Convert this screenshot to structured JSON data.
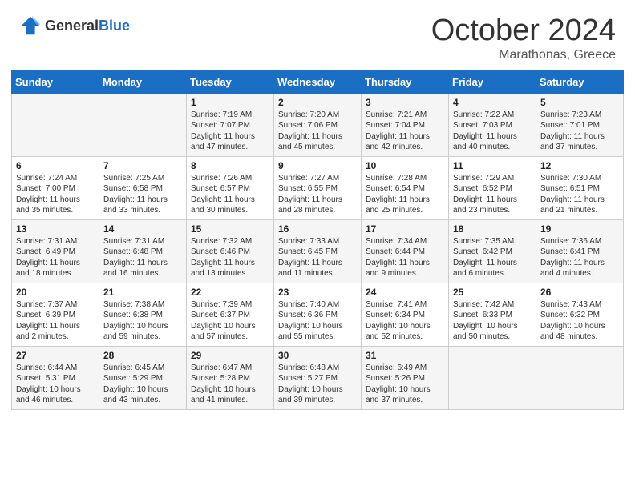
{
  "header": {
    "logo_general": "General",
    "logo_blue": "Blue",
    "month": "October 2024",
    "location": "Marathonas, Greece"
  },
  "weekdays": [
    "Sunday",
    "Monday",
    "Tuesday",
    "Wednesday",
    "Thursday",
    "Friday",
    "Saturday"
  ],
  "weeks": [
    [
      {
        "day": "",
        "sunrise": "",
        "sunset": "",
        "daylight": ""
      },
      {
        "day": "",
        "sunrise": "",
        "sunset": "",
        "daylight": ""
      },
      {
        "day": "1",
        "sunrise": "Sunrise: 7:19 AM",
        "sunset": "Sunset: 7:07 PM",
        "daylight": "Daylight: 11 hours and 47 minutes."
      },
      {
        "day": "2",
        "sunrise": "Sunrise: 7:20 AM",
        "sunset": "Sunset: 7:06 PM",
        "daylight": "Daylight: 11 hours and 45 minutes."
      },
      {
        "day": "3",
        "sunrise": "Sunrise: 7:21 AM",
        "sunset": "Sunset: 7:04 PM",
        "daylight": "Daylight: 11 hours and 42 minutes."
      },
      {
        "day": "4",
        "sunrise": "Sunrise: 7:22 AM",
        "sunset": "Sunset: 7:03 PM",
        "daylight": "Daylight: 11 hours and 40 minutes."
      },
      {
        "day": "5",
        "sunrise": "Sunrise: 7:23 AM",
        "sunset": "Sunset: 7:01 PM",
        "daylight": "Daylight: 11 hours and 37 minutes."
      }
    ],
    [
      {
        "day": "6",
        "sunrise": "Sunrise: 7:24 AM",
        "sunset": "Sunset: 7:00 PM",
        "daylight": "Daylight: 11 hours and 35 minutes."
      },
      {
        "day": "7",
        "sunrise": "Sunrise: 7:25 AM",
        "sunset": "Sunset: 6:58 PM",
        "daylight": "Daylight: 11 hours and 33 minutes."
      },
      {
        "day": "8",
        "sunrise": "Sunrise: 7:26 AM",
        "sunset": "Sunset: 6:57 PM",
        "daylight": "Daylight: 11 hours and 30 minutes."
      },
      {
        "day": "9",
        "sunrise": "Sunrise: 7:27 AM",
        "sunset": "Sunset: 6:55 PM",
        "daylight": "Daylight: 11 hours and 28 minutes."
      },
      {
        "day": "10",
        "sunrise": "Sunrise: 7:28 AM",
        "sunset": "Sunset: 6:54 PM",
        "daylight": "Daylight: 11 hours and 25 minutes."
      },
      {
        "day": "11",
        "sunrise": "Sunrise: 7:29 AM",
        "sunset": "Sunset: 6:52 PM",
        "daylight": "Daylight: 11 hours and 23 minutes."
      },
      {
        "day": "12",
        "sunrise": "Sunrise: 7:30 AM",
        "sunset": "Sunset: 6:51 PM",
        "daylight": "Daylight: 11 hours and 21 minutes."
      }
    ],
    [
      {
        "day": "13",
        "sunrise": "Sunrise: 7:31 AM",
        "sunset": "Sunset: 6:49 PM",
        "daylight": "Daylight: 11 hours and 18 minutes."
      },
      {
        "day": "14",
        "sunrise": "Sunrise: 7:31 AM",
        "sunset": "Sunset: 6:48 PM",
        "daylight": "Daylight: 11 hours and 16 minutes."
      },
      {
        "day": "15",
        "sunrise": "Sunrise: 7:32 AM",
        "sunset": "Sunset: 6:46 PM",
        "daylight": "Daylight: 11 hours and 13 minutes."
      },
      {
        "day": "16",
        "sunrise": "Sunrise: 7:33 AM",
        "sunset": "Sunset: 6:45 PM",
        "daylight": "Daylight: 11 hours and 11 minutes."
      },
      {
        "day": "17",
        "sunrise": "Sunrise: 7:34 AM",
        "sunset": "Sunset: 6:44 PM",
        "daylight": "Daylight: 11 hours and 9 minutes."
      },
      {
        "day": "18",
        "sunrise": "Sunrise: 7:35 AM",
        "sunset": "Sunset: 6:42 PM",
        "daylight": "Daylight: 11 hours and 6 minutes."
      },
      {
        "day": "19",
        "sunrise": "Sunrise: 7:36 AM",
        "sunset": "Sunset: 6:41 PM",
        "daylight": "Daylight: 11 hours and 4 minutes."
      }
    ],
    [
      {
        "day": "20",
        "sunrise": "Sunrise: 7:37 AM",
        "sunset": "Sunset: 6:39 PM",
        "daylight": "Daylight: 11 hours and 2 minutes."
      },
      {
        "day": "21",
        "sunrise": "Sunrise: 7:38 AM",
        "sunset": "Sunset: 6:38 PM",
        "daylight": "Daylight: 10 hours and 59 minutes."
      },
      {
        "day": "22",
        "sunrise": "Sunrise: 7:39 AM",
        "sunset": "Sunset: 6:37 PM",
        "daylight": "Daylight: 10 hours and 57 minutes."
      },
      {
        "day": "23",
        "sunrise": "Sunrise: 7:40 AM",
        "sunset": "Sunset: 6:36 PM",
        "daylight": "Daylight: 10 hours and 55 minutes."
      },
      {
        "day": "24",
        "sunrise": "Sunrise: 7:41 AM",
        "sunset": "Sunset: 6:34 PM",
        "daylight": "Daylight: 10 hours and 52 minutes."
      },
      {
        "day": "25",
        "sunrise": "Sunrise: 7:42 AM",
        "sunset": "Sunset: 6:33 PM",
        "daylight": "Daylight: 10 hours and 50 minutes."
      },
      {
        "day": "26",
        "sunrise": "Sunrise: 7:43 AM",
        "sunset": "Sunset: 6:32 PM",
        "daylight": "Daylight: 10 hours and 48 minutes."
      }
    ],
    [
      {
        "day": "27",
        "sunrise": "Sunrise: 6:44 AM",
        "sunset": "Sunset: 5:31 PM",
        "daylight": "Daylight: 10 hours and 46 minutes."
      },
      {
        "day": "28",
        "sunrise": "Sunrise: 6:45 AM",
        "sunset": "Sunset: 5:29 PM",
        "daylight": "Daylight: 10 hours and 43 minutes."
      },
      {
        "day": "29",
        "sunrise": "Sunrise: 6:47 AM",
        "sunset": "Sunset: 5:28 PM",
        "daylight": "Daylight: 10 hours and 41 minutes."
      },
      {
        "day": "30",
        "sunrise": "Sunrise: 6:48 AM",
        "sunset": "Sunset: 5:27 PM",
        "daylight": "Daylight: 10 hours and 39 minutes."
      },
      {
        "day": "31",
        "sunrise": "Sunrise: 6:49 AM",
        "sunset": "Sunset: 5:26 PM",
        "daylight": "Daylight: 10 hours and 37 minutes."
      },
      {
        "day": "",
        "sunrise": "",
        "sunset": "",
        "daylight": ""
      },
      {
        "day": "",
        "sunrise": "",
        "sunset": "",
        "daylight": ""
      }
    ]
  ]
}
